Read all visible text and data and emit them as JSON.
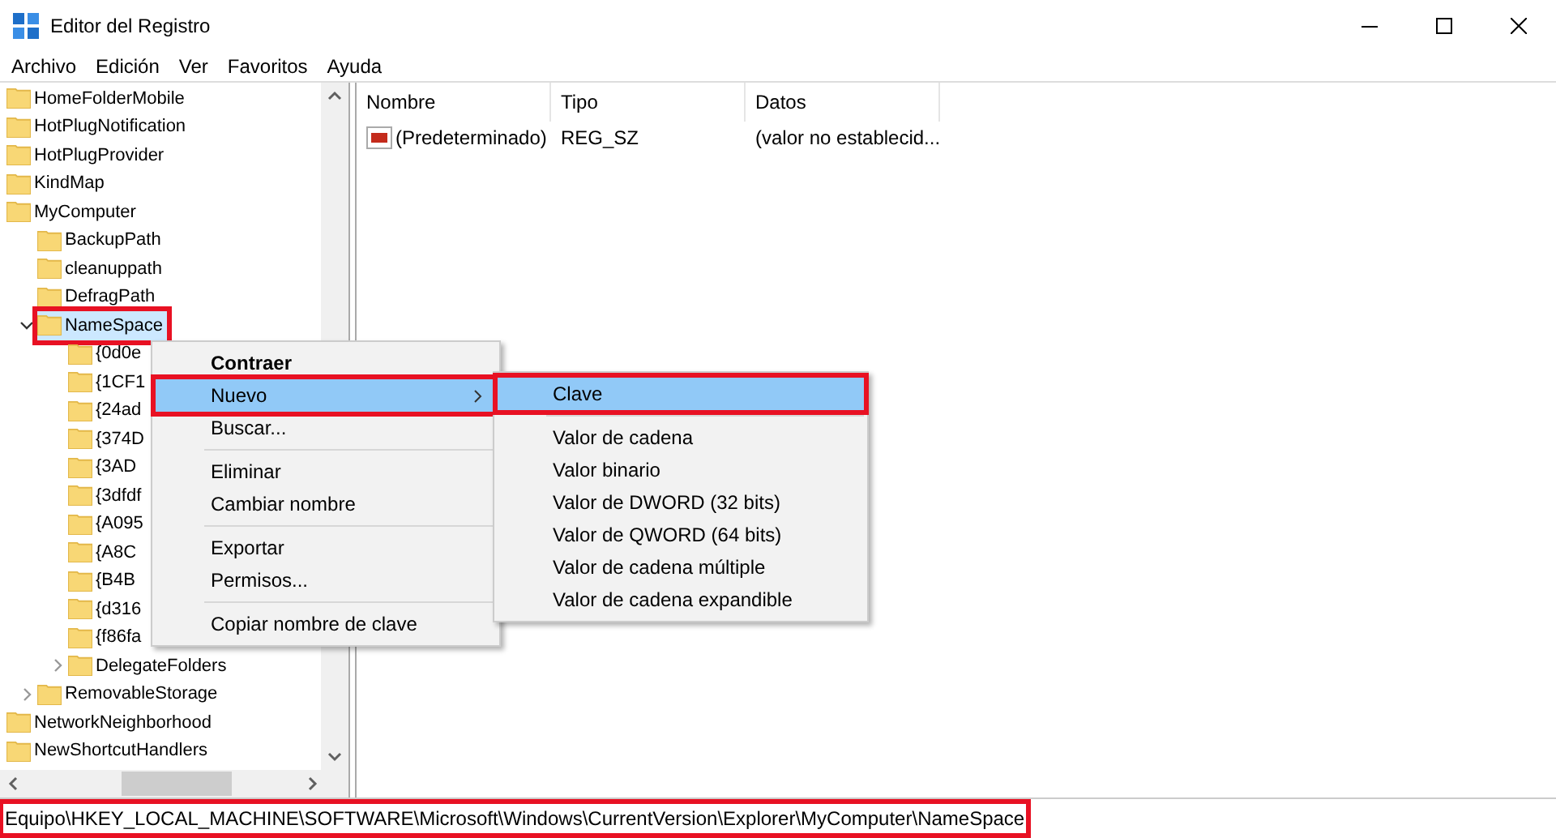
{
  "window": {
    "title": "Editor del Registro"
  },
  "menu_bar": [
    "Archivo",
    "Edición",
    "Ver",
    "Favoritos",
    "Ayuda"
  ],
  "tree": [
    {
      "label": "HomeFolderMobile"
    },
    {
      "label": "HotPlugNotification"
    },
    {
      "label": "HotPlugProvider"
    },
    {
      "label": "KindMap"
    },
    {
      "label": "MyComputer",
      "children": [
        {
          "label": "BackupPath"
        },
        {
          "label": "cleanuppath"
        },
        {
          "label": "DefragPath"
        },
        {
          "label": "NameSpace",
          "expanded": true,
          "selected": true,
          "highlighted": true,
          "children": [
            {
              "label": "{0d0e"
            },
            {
              "label": "{1CF1"
            },
            {
              "label": "{24ad"
            },
            {
              "label": "{374D"
            },
            {
              "label": "{3AD"
            },
            {
              "label": "{3dfdf"
            },
            {
              "label": "{A095"
            },
            {
              "label": "{A8C"
            },
            {
              "label": "{B4B"
            },
            {
              "label": "{d316"
            },
            {
              "label": "{f86fa"
            },
            {
              "label": "DelegateFolders",
              "expanded": false
            }
          ]
        },
        {
          "label": "RemovableStorage",
          "expanded": false
        }
      ]
    },
    {
      "label": "NetworkNeighborhood"
    },
    {
      "label": "NewShortcutHandlers"
    }
  ],
  "list": {
    "columns": [
      "Nombre",
      "Tipo",
      "Datos"
    ],
    "rows": [
      {
        "name": "(Predeterminado)",
        "type": "REG_SZ",
        "data": "(valor no establecid..."
      }
    ]
  },
  "context_menu": [
    {
      "kind": "item",
      "label": "Contraer",
      "default": true
    },
    {
      "kind": "item",
      "label": "Nuevo",
      "submenu": true,
      "selected": true,
      "highlighted": true
    },
    {
      "kind": "item",
      "label": "Buscar..."
    },
    {
      "kind": "separator"
    },
    {
      "kind": "item",
      "label": "Eliminar"
    },
    {
      "kind": "item",
      "label": "Cambiar nombre"
    },
    {
      "kind": "separator"
    },
    {
      "kind": "item",
      "label": "Exportar"
    },
    {
      "kind": "item",
      "label": "Permisos..."
    },
    {
      "kind": "separator"
    },
    {
      "kind": "item",
      "label": "Copiar nombre de clave"
    }
  ],
  "submenu": [
    {
      "kind": "item",
      "label": "Clave",
      "selected": true,
      "highlighted": true
    },
    {
      "kind": "separator"
    },
    {
      "kind": "item",
      "label": "Valor de cadena"
    },
    {
      "kind": "item",
      "label": "Valor binario"
    },
    {
      "kind": "item",
      "label": "Valor de DWORD (32 bits)"
    },
    {
      "kind": "item",
      "label": "Valor de QWORD (64 bits)"
    },
    {
      "kind": "item",
      "label": "Valor de cadena múltiple"
    },
    {
      "kind": "item",
      "label": "Valor de cadena expandible"
    }
  ],
  "status_bar": {
    "path": "Equipo\\HKEY_LOCAL_MACHINE\\SOFTWARE\\Microsoft\\Windows\\CurrentVersion\\Explorer\\MyComputer\\NameSpace",
    "highlighted": true
  }
}
